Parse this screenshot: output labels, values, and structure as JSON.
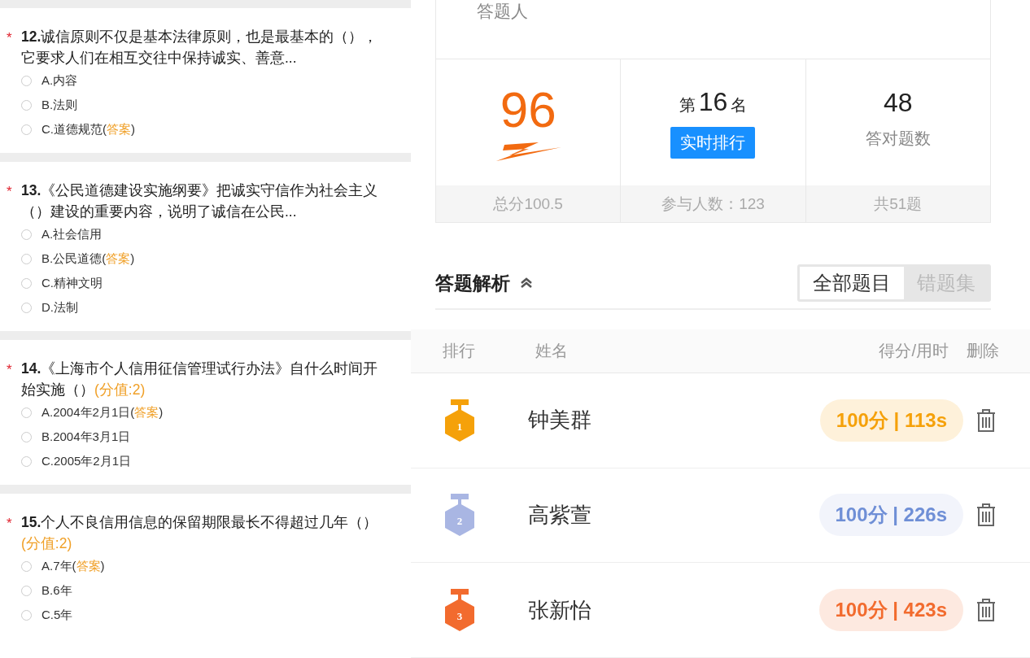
{
  "required_mark": "*",
  "questions": [
    {
      "text": "**12.**诚信原则不仅是基本法律原则，也是最基本的（），它要求人们在相互交往中保持诚实、善意...",
      "options": [
        {
          "label": "A.内容",
          "selected": false
        },
        {
          "label": "B.法则",
          "selected": false
        },
        {
          "label": "C.道德规范(",
          "answer": "答案",
          "tail": ")",
          "selected": false
        }
      ]
    },
    {
      "text": "**13.**《公民道德建设实施纲要》把诚实守信作为社会主义（）建设的重要内容，说明了诚信在公民...",
      "options": [
        {
          "label": "A.社会信用",
          "selected": false
        },
        {
          "label": "B.公民道德(",
          "answer": "答案",
          "tail": ")",
          "selected": false
        },
        {
          "label": "C.精神文明",
          "selected": false
        },
        {
          "label": "D.法制",
          "selected": false
        }
      ]
    },
    {
      "text": "**14.**《上海市个人信用征信管理试行办法》自什么时间开始实施（）",
      "score": "(分值:2)",
      "options": [
        {
          "label": "A.2004年2月1日(",
          "answer": "答案",
          "tail": ")",
          "selected": false
        },
        {
          "label": "B.2004年3月1日",
          "selected": false
        },
        {
          "label": "C.2005年2月1日",
          "selected": false
        }
      ]
    },
    {
      "text": "**15.**个人不良信用信息的保留期限最长不得超过几年（）",
      "score": "(分值:2)",
      "options": [
        {
          "label": "A.7年(",
          "answer": "答案",
          "tail": ")",
          "selected": false
        },
        {
          "label": "B.6年",
          "selected": false
        },
        {
          "label": "C.5年",
          "selected": false
        }
      ]
    }
  ],
  "summary": {
    "respondent_label": "答题人",
    "score": "96",
    "rank_prefix": "第",
    "rank": "16",
    "rank_suffix": "名",
    "rank_button": "实时排行",
    "correct": "48",
    "correct_label": "答对题数",
    "footer": [
      "总分100.5",
      "参与人数：123",
      "共51题"
    ]
  },
  "analysis": {
    "title": "答题解析",
    "expanded": true,
    "tabs": [
      {
        "label": "全部题目",
        "selected": true
      },
      {
        "label": "错题集",
        "selected": false
      }
    ]
  },
  "ranking": {
    "columns": [
      "排行",
      "姓名",
      "得分/用时",
      "删除"
    ],
    "rows": [
      {
        "rank": "1",
        "name": "钟美群",
        "score": "100分",
        "time": "113s",
        "color": "#f5a10a",
        "divider": "|"
      },
      {
        "rank": "2",
        "name": "高紫萱",
        "score": "100分",
        "time": "226s",
        "color": "#a9b6e3",
        "divider": "|"
      },
      {
        "rank": "3",
        "name": "张新怡",
        "score": "100分",
        "time": "423s",
        "color": "#f26b2e",
        "divider": "|"
      }
    ]
  }
}
